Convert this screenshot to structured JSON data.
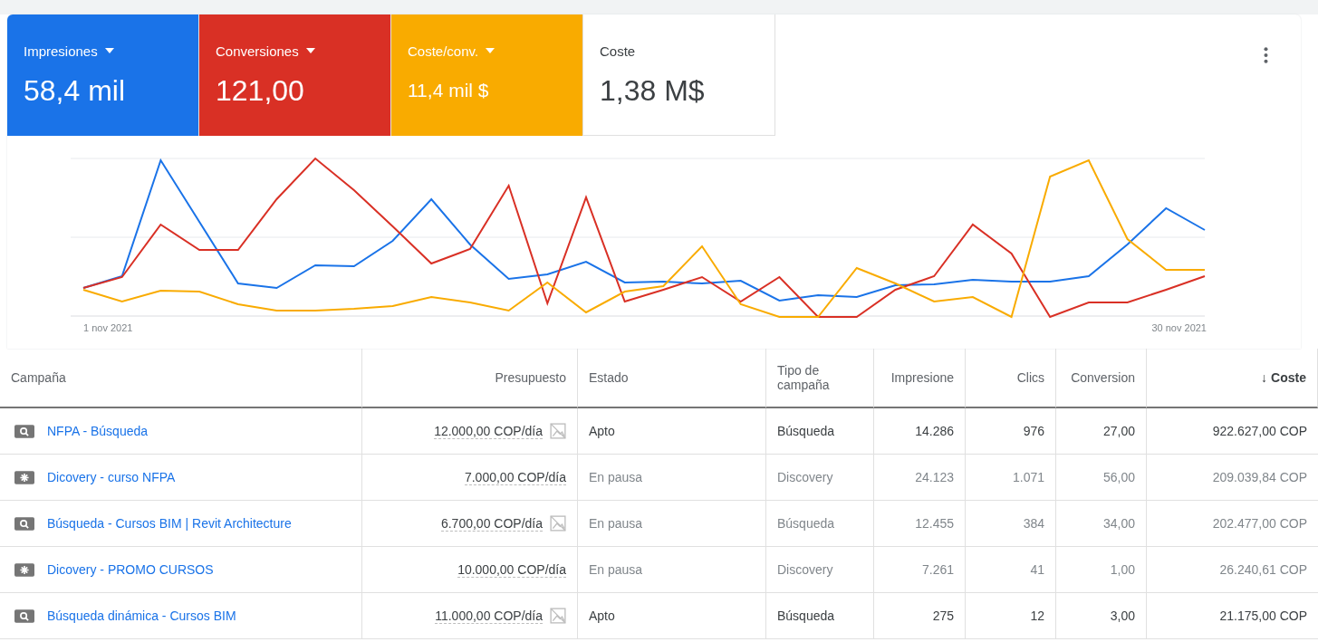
{
  "metrics": [
    {
      "label": "Impresiones",
      "value": "58,4 mil",
      "selected": true,
      "color": "#1a73e8",
      "dropdown": true
    },
    {
      "label": "Conversiones",
      "value": "121,00",
      "selected": true,
      "color": "#d93025",
      "dropdown": true
    },
    {
      "label": "Coste/conv.",
      "value": "11,4 mil $",
      "selected": true,
      "color": "#f9ab00",
      "dropdown": true
    },
    {
      "label": "Coste",
      "value": "1,38 M$",
      "selected": false,
      "dropdown": false
    }
  ],
  "chart": {
    "x_start": "1 nov 2021",
    "x_end": "30 nov 2021"
  },
  "table": {
    "columns": [
      {
        "label": "Campaña"
      },
      {
        "label": "Presupuesto"
      },
      {
        "label": "Estado"
      },
      {
        "label": "Tipo de campaña"
      },
      {
        "label": "Impresione"
      },
      {
        "label": "Clics"
      },
      {
        "label": "Conversion"
      },
      {
        "label": "Coste",
        "sort_arrow": "↓"
      }
    ],
    "rows": [
      {
        "kind": "search",
        "campaign": "NFPA - Búsqueda",
        "budget": "12.000,00 COP/día",
        "budget_flag": true,
        "status": "Apto",
        "paused": false,
        "type": "Búsqueda",
        "impressions": "14.286",
        "clicks": "976",
        "conversions": "27,00",
        "cost": "922.627,00 COP"
      },
      {
        "kind": "discovery",
        "campaign": "Dicovery - curso NFPA",
        "budget": "7.000,00 COP/día",
        "budget_flag": false,
        "status": "En pausa",
        "paused": true,
        "type": "Discovery",
        "impressions": "24.123",
        "clicks": "1.071",
        "conversions": "56,00",
        "cost": "209.039,84 COP"
      },
      {
        "kind": "search",
        "campaign": "Búsqueda - Cursos BIM | Revit Architecture",
        "budget": "6.700,00 COP/día",
        "budget_flag": true,
        "status": "En pausa",
        "paused": true,
        "type": "Búsqueda",
        "impressions": "12.455",
        "clicks": "384",
        "conversions": "34,00",
        "cost": "202.477,00 COP"
      },
      {
        "kind": "discovery",
        "campaign": "Dicovery - PROMO CURSOS",
        "budget": "10.000,00 COP/día",
        "budget_flag": false,
        "status": "En pausa",
        "paused": true,
        "type": "Discovery",
        "impressions": "7.261",
        "clicks": "41",
        "conversions": "1,00",
        "cost": "26.240,61 COP"
      },
      {
        "kind": "search",
        "campaign": "Búsqueda dinámica - Cursos BIM",
        "budget": "11.000,00 COP/día",
        "budget_flag": true,
        "status": "Apto",
        "paused": false,
        "type": "Búsqueda",
        "impressions": "275",
        "clicks": "12",
        "conversions": "3,00",
        "cost": "21.175,00 COP"
      }
    ]
  }
}
